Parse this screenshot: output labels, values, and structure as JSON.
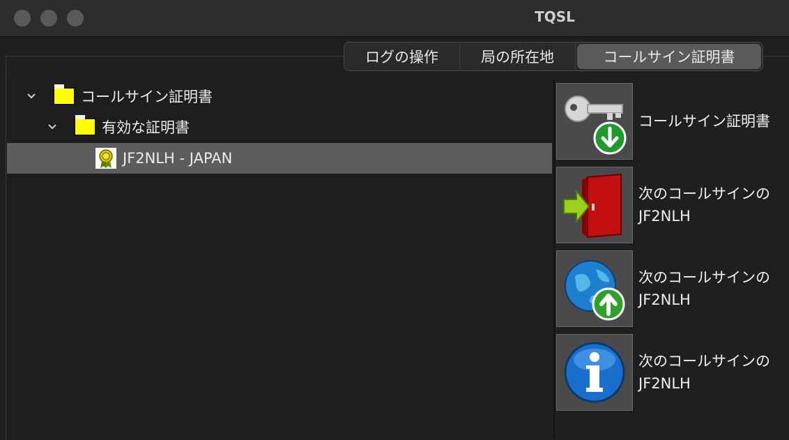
{
  "window": {
    "title": "TQSL"
  },
  "tabs": [
    {
      "label": "ログの操作",
      "active": false
    },
    {
      "label": "局の所在地",
      "active": false
    },
    {
      "label": "コールサイン証明書",
      "active": true
    }
  ],
  "tree": {
    "root": {
      "label": "コールサイン証明書"
    },
    "group": {
      "label": "有効な証明書"
    },
    "item": {
      "label": "JF2NLH - JAPAN",
      "selected": true
    }
  },
  "actions": [
    {
      "icon": "key-download-icon",
      "line1": "コールサイン証明書",
      "line2": ""
    },
    {
      "icon": "door-export-icon",
      "line1": "次のコールサインの",
      "line2": "JF2NLH"
    },
    {
      "icon": "globe-upload-icon",
      "line1": "次のコールサインの",
      "line2": "JF2NLH"
    },
    {
      "icon": "info-icon",
      "line1": "次のコールサインの",
      "line2": "JF2NLH"
    }
  ],
  "colors": {
    "folder": "#ffff00",
    "selected_row": "#5c5c5c",
    "accent_green": "#22aa33"
  }
}
